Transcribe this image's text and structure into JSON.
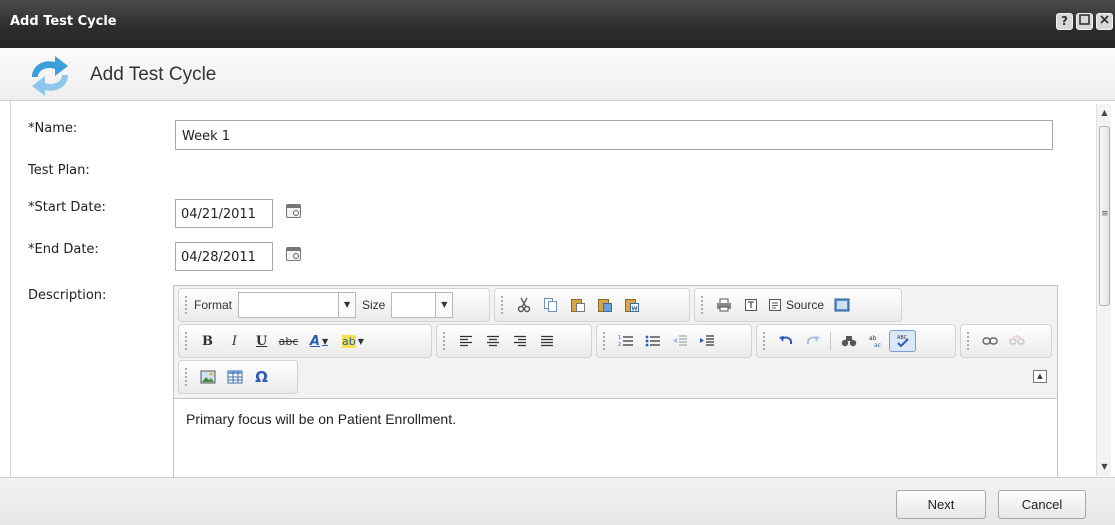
{
  "window": {
    "title": "Add Test Cycle",
    "controls": {
      "help": "?",
      "maximize": "▫",
      "close": "×"
    }
  },
  "header": {
    "title": "Add Test Cycle",
    "icon": "refresh-icon",
    "icon_color": "#3ea7e0"
  },
  "form": {
    "name_label": "*Name:",
    "name_value": "Week 1",
    "test_plan_label": "Test Plan:",
    "start_date_label": "*Start Date:",
    "start_date_value": "04/21/2011",
    "end_date_label": "*End Date:",
    "end_date_value": "04/28/2011",
    "description_label": "Description:"
  },
  "editor": {
    "format_label": "Format",
    "format_value": "",
    "size_label": "Size",
    "size_value": "",
    "source_label": "Source",
    "toolbar_icons": {
      "bold": "B",
      "italic": "I",
      "underline": "U",
      "strike": "abc",
      "font_color": "A",
      "bg_color": "ab",
      "omega": "Ω"
    },
    "content": "Primary focus will be on Patient Enrollment."
  },
  "footer": {
    "next_label": "Next",
    "cancel_label": "Cancel"
  }
}
